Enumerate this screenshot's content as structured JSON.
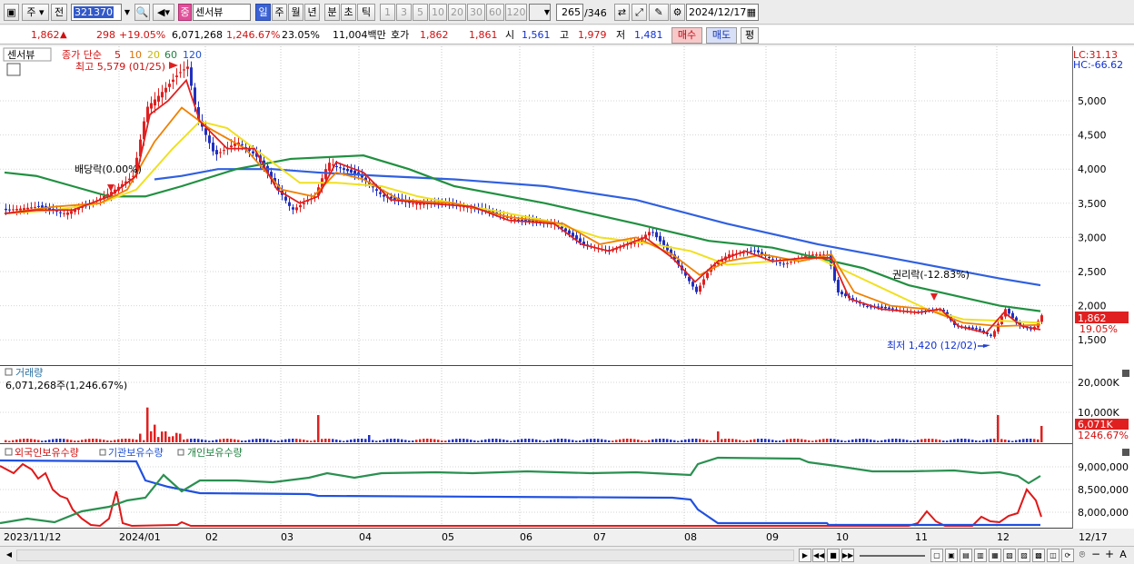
{
  "toolbar": {
    "mode": "주",
    "prev": "전",
    "code": "321370",
    "name_badge": "중",
    "stock_name": "센서뷰",
    "periods": [
      "일",
      "주",
      "월",
      "년",
      "분",
      "초",
      "틱"
    ],
    "intervals": [
      "1",
      "3",
      "5",
      "10",
      "20",
      "30",
      "60",
      "120"
    ],
    "page": "265",
    "page_total": "/346",
    "date": "2024/12/17"
  },
  "quote": {
    "price": "1,862",
    "change_arrow": "▲",
    "change": "298",
    "change_pct": "+19.05%",
    "volume": "6,071,268",
    "volume_pct": "1,246.67%",
    "turnover": "23.05%",
    "amount": "11,004백만",
    "hoga_label": "호가",
    "ask": "1,862",
    "bid": "1,861",
    "open_label": "시",
    "open": "1,561",
    "high_label": "고",
    "high": "1,979",
    "low_label": "저",
    "low": "1,481",
    "buy": "매수",
    "sell": "매도",
    "avg": "평"
  },
  "price_panel": {
    "title": "센서뷰",
    "ma_label": "종가 단순",
    "ma": [
      "5",
      "10",
      "20",
      "60",
      "120"
    ],
    "high_note": "최고 5,579 (01/25)",
    "low_note": "최저 1,420 (12/02)",
    "div_note": "배당락(0.00%)",
    "rights_note": "권리락(-12.83%)",
    "lc": "LC:31.13",
    "hc": "HC:-66.62",
    "last_price": "1,862",
    "last_pct": "19.05%",
    "y_ticks": [
      "5,000",
      "4,500",
      "4,000",
      "3,500",
      "3,000",
      "2,500",
      "2,000",
      "1,500"
    ]
  },
  "volume_panel": {
    "title": "거래량",
    "value": "6,071,268주(1,246.67%)",
    "y_ticks": [
      "20,000K",
      "10,000K"
    ],
    "last": "6,071K",
    "last_pct": "1246.67%"
  },
  "holdings_panel": {
    "series": [
      "외국인보유수량",
      "기관보유수량",
      "개인보유수량"
    ],
    "y_ticks": [
      "9,000,000",
      "8,500,000",
      "8,000,000"
    ]
  },
  "x_labels": [
    "2023/11/12",
    "2024/01",
    "02",
    "03",
    "04",
    "05",
    "06",
    "07",
    "08",
    "09",
    "10",
    "11",
    "12",
    "12/17"
  ],
  "colors": {
    "ma5": "#e02020",
    "ma10": "#f08000",
    "ma20": "#f0e020",
    "ma60": "#209040",
    "ma120": "#3060e0",
    "up": "#e02020",
    "down": "#2030c0"
  }
}
